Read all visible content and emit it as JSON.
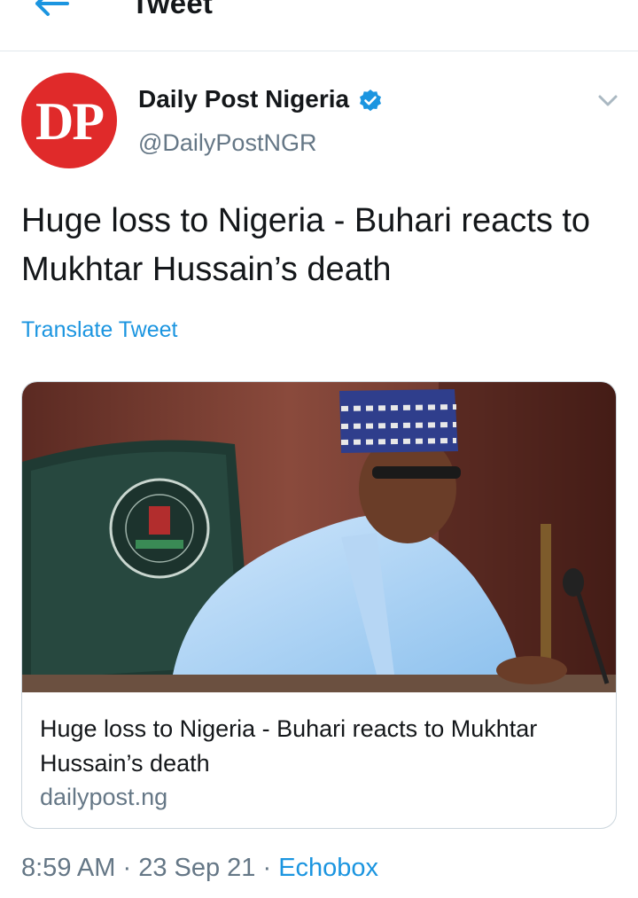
{
  "header": {
    "title": "Tweet",
    "back_icon": "arrow-left-icon"
  },
  "tweet": {
    "avatar_text": "DP",
    "author_name": "Daily Post Nigeria",
    "author_handle": "@DailyPostNGR",
    "text": "Huge loss to Nigeria - Buhari reacts to Mukhtar Hussain’s death",
    "translate_label": "Translate Tweet",
    "time": "8:59 AM",
    "date": "23 Sep 21",
    "source": "Echobox",
    "separator": " · "
  },
  "card": {
    "title": "Huge loss to Nigeria - Buhari reacts to Mukhtar Hussain’s death",
    "domain": "dailypost.ng"
  },
  "colors": {
    "accent": "#1b95e0",
    "avatar": "#e02a2a",
    "secondary_text": "#657786",
    "border": "#e1e8ed"
  }
}
